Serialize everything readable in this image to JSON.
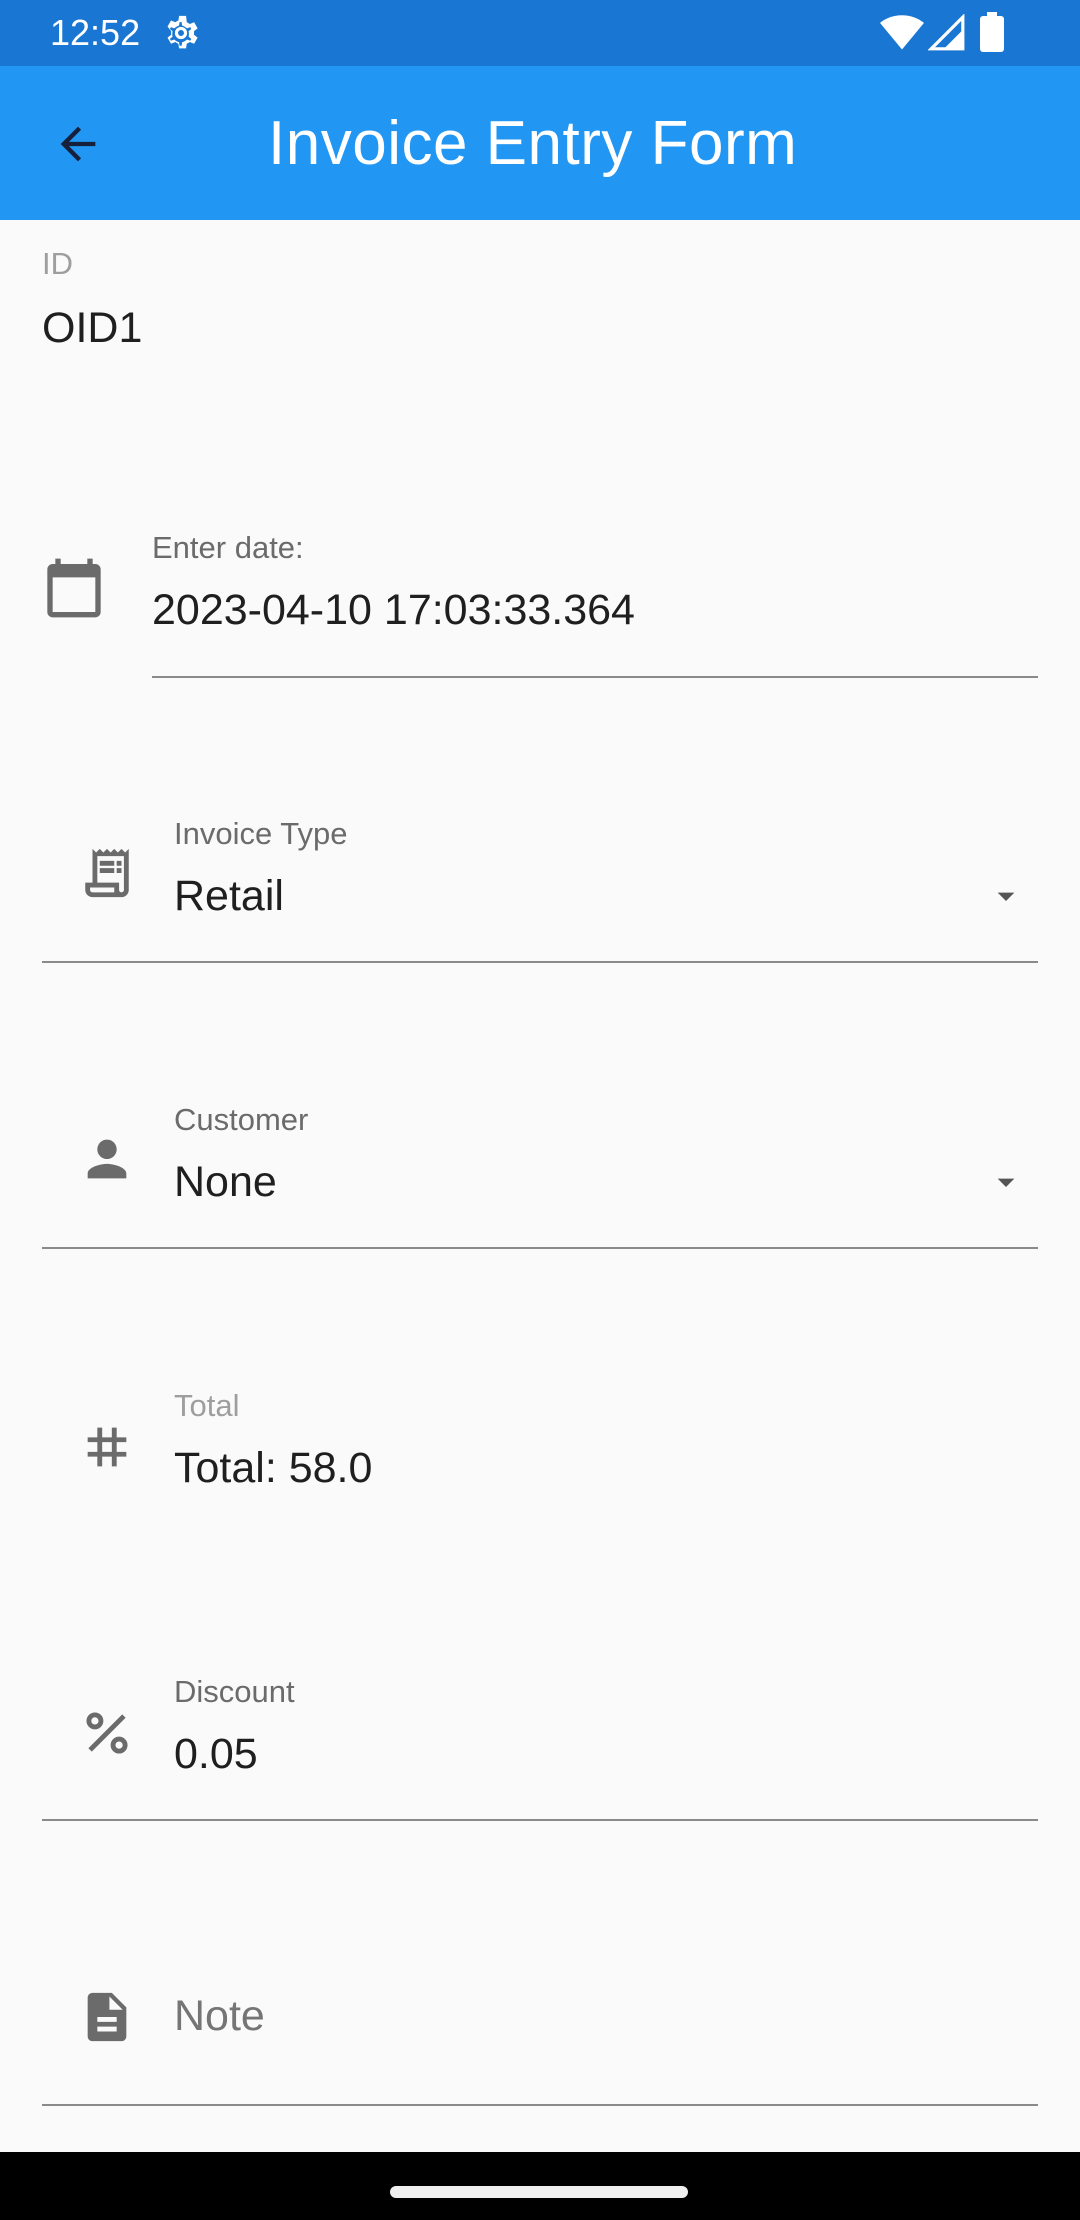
{
  "status_bar": {
    "time": "12:52"
  },
  "app_bar": {
    "title": "Invoice Entry Form"
  },
  "form": {
    "id": {
      "label": "ID",
      "value": "OID1"
    },
    "date": {
      "label": "Enter date:",
      "value": "2023-04-10 17:03:33.364"
    },
    "invoice_type": {
      "label": "Invoice Type",
      "value": "Retail"
    },
    "customer": {
      "label": "Customer",
      "value": "None"
    },
    "total": {
      "label": "Total",
      "value": "Total: 58.0"
    },
    "discount": {
      "label": "Discount",
      "value": "0.05"
    },
    "note": {
      "placeholder": "Note"
    }
  },
  "colors": {
    "status_bar": "#1976d2",
    "app_bar": "#2196f3",
    "background": "#fafafa",
    "icon": "#6b6b6b"
  }
}
